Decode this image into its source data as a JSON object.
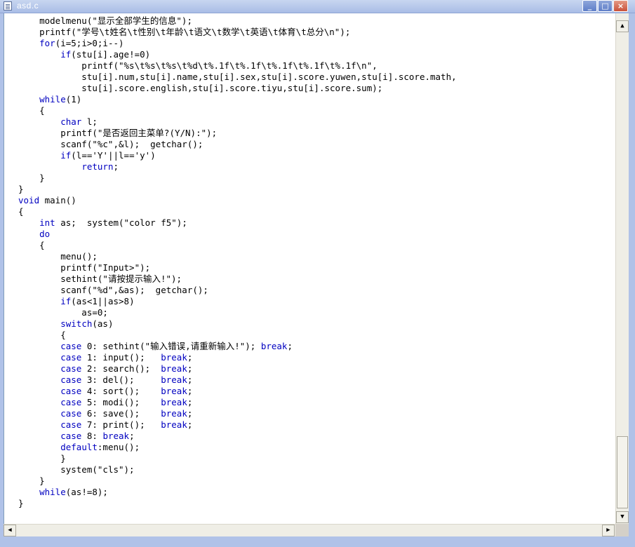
{
  "window": {
    "title": "asd.c",
    "buttons": {
      "minimize": "_",
      "maximize": "□",
      "close": "×"
    }
  },
  "editor": {
    "language": "C",
    "keyword_color": "#0000c0",
    "lines": [
      "    modelmenu(\"显示全部学生的信息\");",
      "    printf(\"学号\\t姓名\\t性别\\t年龄\\t语文\\t数学\\t英语\\t体育\\t总分\\n\");",
      "    for(i=5;i>0;i--)",
      "        if(stu[i].age!=0)",
      "            printf(\"%s\\t%s\\t%s\\t%d\\t%.1f\\t%.1f\\t%.1f\\t%.1f\\t%.1f\\n\",",
      "            stu[i].num,stu[i].name,stu[i].sex,stu[i].score.yuwen,stu[i].score.math,",
      "            stu[i].score.english,stu[i].score.tiyu,stu[i].score.sum);",
      "    while(1)",
      "    {",
      "        char l;",
      "        printf(\"是否返回主菜单?(Y/N):\");",
      "        scanf(\"%c\",&l);  getchar();",
      "        if(l=='Y'||l=='y')",
      "            return;",
      "    }",
      "}",
      "void main()",
      "{",
      "    int as;  system(\"color f5\");",
      "    do",
      "    {",
      "        menu();",
      "        printf(\"Input>\");",
      "        sethint(\"请按提示输入!\");",
      "        scanf(\"%d\",&as);  getchar();",
      "        if(as<1||as>8)",
      "            as=0;",
      "        switch(as)",
      "        {",
      "        case 0: sethint(\"输入错误,请重新输入!\"); break;",
      "        case 1: input();   break;",
      "        case 2: search();  break;",
      "        case 3: del();     break;",
      "        case 4: sort();    break;",
      "        case 5: modi();    break;",
      "        case 6: save();    break;",
      "        case 7: print();   break;",
      "        case 8: break;",
      "        default:menu();",
      "        }",
      "        system(\"cls\");",
      "    }",
      "    while(as!=8);",
      "}"
    ]
  },
  "scrollbars": {
    "vertical": {
      "up_icon": "arrow-up",
      "down_icon": "arrow-down",
      "position_fraction": 0.92
    },
    "horizontal": {
      "left_icon": "arrow-left",
      "right_icon": "arrow-right",
      "position_fraction": 0.0
    }
  }
}
